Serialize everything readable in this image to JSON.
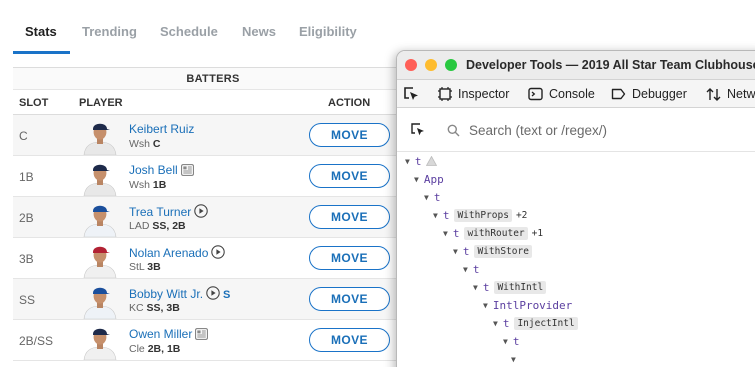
{
  "tabs": [
    "Stats",
    "Trending",
    "Schedule",
    "News",
    "Eligibility"
  ],
  "section_title": "BATTERS",
  "columns": {
    "slot": "SLOT",
    "player": "PLAYER",
    "action": "ACTION"
  },
  "players": [
    {
      "slot": "C",
      "name": "Keibert Ruiz",
      "team": "Wsh",
      "pos": "C",
      "badge": "",
      "jersey": "#e8e8e8",
      "cap": "#1e2a4a"
    },
    {
      "slot": "1B",
      "name": "Josh Bell",
      "team": "Wsh",
      "pos": "1B",
      "badge": "news",
      "jersey": "#e8e8e8",
      "cap": "#1e2a4a"
    },
    {
      "slot": "2B",
      "name": "Trea Turner",
      "team": "LAD",
      "pos": "SS, 2B",
      "badge": "play",
      "jersey": "#eef2f7",
      "cap": "#1b4f9c"
    },
    {
      "slot": "3B",
      "name": "Nolan Arenado",
      "team": "StL",
      "pos": "3B",
      "badge": "play",
      "jersey": "#f0f0f0",
      "cap": "#b22234"
    },
    {
      "slot": "SS",
      "name": "Bobby Witt Jr.",
      "team": "KC",
      "pos": "SS, 3B",
      "badge": "play-s",
      "jersey": "#eef2f7",
      "cap": "#1b4f9c"
    },
    {
      "slot": "2B/SS",
      "name": "Owen Miller",
      "team": "Cle",
      "pos": "2B, 1B",
      "badge": "news",
      "jersey": "#f0f0f0",
      "cap": "#1e2a4a"
    }
  ],
  "move_label": "MOVE",
  "s_badge": "S",
  "devtools": {
    "title": "Developer Tools — 2019 All Star Team Clubhouse",
    "tabs": [
      "Inspector",
      "Console",
      "Debugger",
      "Network"
    ],
    "search_placeholder": "Search (text or /regex/)",
    "tree": [
      {
        "label": "t",
        "hoc": "",
        "plus": "",
        "warn": true
      },
      {
        "label": "App",
        "hoc": "",
        "plus": "",
        "warn": false
      },
      {
        "label": "t",
        "hoc": "",
        "plus": "",
        "warn": false
      },
      {
        "label": "t",
        "hoc": "WithProps",
        "plus": "+2",
        "warn": false
      },
      {
        "label": "t",
        "hoc": "withRouter",
        "plus": "+1",
        "warn": false
      },
      {
        "label": "t",
        "hoc": "WithStore",
        "plus": "",
        "warn": false
      },
      {
        "label": "t",
        "hoc": "",
        "plus": "",
        "warn": false
      },
      {
        "label": "t",
        "hoc": "WithIntl",
        "plus": "",
        "warn": false
      },
      {
        "label": "IntlProvider",
        "hoc": "",
        "plus": "",
        "warn": false
      },
      {
        "label": "t",
        "hoc": "InjectIntl",
        "plus": "",
        "warn": false
      },
      {
        "label": "t",
        "hoc": "",
        "plus": "",
        "warn": false
      },
      {
        "label": "",
        "hoc": "",
        "plus": "",
        "warn": false
      }
    ]
  },
  "colors": {
    "accent": "#1a73c8",
    "link": "#1a6fb8",
    "close": "#ff5f57",
    "minimize": "#febc2e",
    "zoom": "#28c840",
    "tree_text": "#5b3fa0"
  }
}
